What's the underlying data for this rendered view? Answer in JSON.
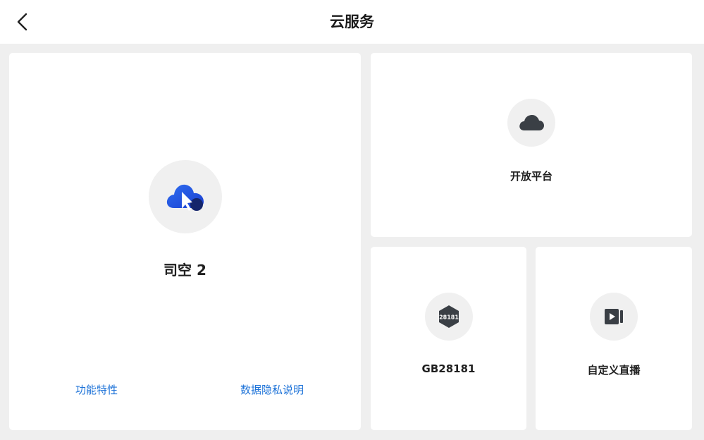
{
  "header": {
    "title": "云服务"
  },
  "main_card": {
    "label": "司空 2",
    "icon": "cloud-cursor-icon",
    "links": {
      "features": "功能特性",
      "privacy": "数据隐私说明"
    }
  },
  "open_platform": {
    "label": "开放平台",
    "icon": "cloud-icon"
  },
  "gb28181": {
    "label": "GB28181",
    "icon": "gb28181-hexagon-icon",
    "icon_text": "28181"
  },
  "custom_live": {
    "label": "自定义直播",
    "icon": "live-play-icon"
  },
  "colors": {
    "accent": "#1e73d8",
    "icon_dark": "#3a3f45",
    "background": "#efefef"
  }
}
